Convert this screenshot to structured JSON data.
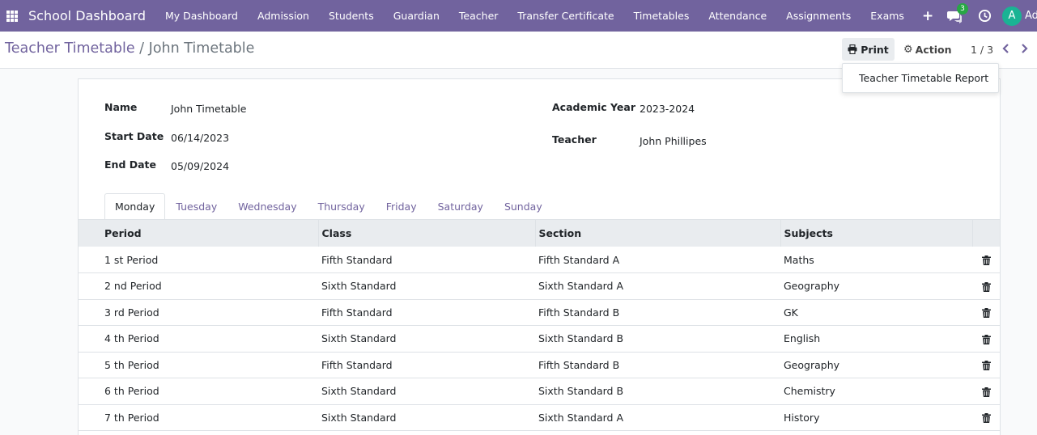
{
  "navbar": {
    "brand": "School Dashboard",
    "menu": [
      {
        "label": "My Dashboard"
      },
      {
        "label": "Admission"
      },
      {
        "label": "Students"
      },
      {
        "label": "Guardian"
      },
      {
        "label": "Teacher"
      },
      {
        "label": "Transfer Certificate"
      },
      {
        "label": "Timetables"
      },
      {
        "label": "Attendance"
      },
      {
        "label": "Assignments"
      },
      {
        "label": "Exams"
      }
    ],
    "chat_count": "3",
    "avatar_initial": "A",
    "user_name": "Ad",
    "accent_color": "#71639e"
  },
  "control": {
    "breadcrumb_parent": "Teacher Timetable",
    "breadcrumb_sep": "/",
    "breadcrumb_current": "John Timetable",
    "print_label": "Print",
    "action_label": "Action",
    "pager": "1 / 3"
  },
  "print_menu": {
    "items": [
      {
        "label": "Teacher Timetable Report"
      }
    ]
  },
  "form": {
    "name_label": "Name",
    "name_value": "John Timetable",
    "start_label": "Start Date",
    "start_value": "06/14/2023",
    "end_label": "End Date",
    "end_value": "05/09/2024",
    "year_label": "Academic Year",
    "year_value": "2023-2024",
    "teacher_label": "Teacher",
    "teacher_value": "John Phillipes"
  },
  "tabs": [
    {
      "label": "Monday"
    },
    {
      "label": "Tuesday"
    },
    {
      "label": "Wednesday"
    },
    {
      "label": "Thursday"
    },
    {
      "label": "Friday"
    },
    {
      "label": "Saturday"
    },
    {
      "label": "Sunday"
    }
  ],
  "table": {
    "headers": [
      "Period",
      "Class",
      "Section",
      "Subjects"
    ],
    "rows": [
      {
        "period": "1 st Period",
        "class": "Fifth Standard",
        "section": "Fifth Standard A",
        "subject": "Maths"
      },
      {
        "period": "2 nd Period",
        "class": "Sixth Standard",
        "section": "Sixth Standard A",
        "subject": "Geography"
      },
      {
        "period": "3 rd Period",
        "class": "Fifth Standard",
        "section": "Fifth Standard B",
        "subject": "GK"
      },
      {
        "period": "4 th Period",
        "class": "Sixth Standard",
        "section": "Sixth Standard B",
        "subject": "English"
      },
      {
        "period": "5 th Period",
        "class": "Fifth Standard",
        "section": "Fifth Standard B",
        "subject": "Geography"
      },
      {
        "period": "6 th Period",
        "class": "Sixth Standard",
        "section": "Sixth Standard B",
        "subject": "Chemistry"
      },
      {
        "period": "7 th Period",
        "class": "Sixth Standard",
        "section": "Sixth Standard A",
        "subject": "History"
      }
    ]
  }
}
